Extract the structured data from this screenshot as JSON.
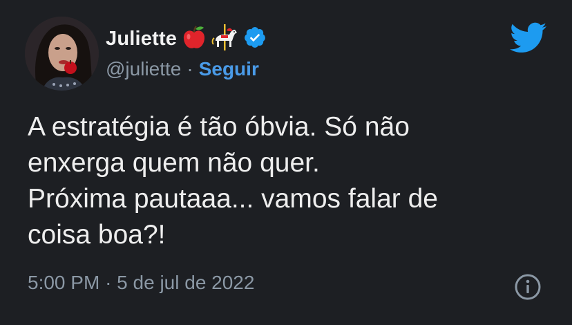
{
  "author": {
    "name": "Juliette",
    "handle": "@juliette",
    "separator": "·",
    "follow_label": "Seguir"
  },
  "tweet": {
    "lines": [
      "A estratégia é tão óbvia. Só não",
      "enxerga quem não quer.",
      "Próxima pautaaa... vamos falar de",
      "coisa boa?!"
    ],
    "time": "5:00 PM",
    "date": "5 de jul de 2022"
  },
  "colors": {
    "background": "#1d1f23",
    "accent": "#1d9bf0",
    "follow": "#4a9be8",
    "muted": "#8b98a5"
  },
  "icons": [
    "apple-emoji-icon",
    "carousel-horse-emoji-icon",
    "verified-badge-icon",
    "twitter-bird-icon",
    "info-icon"
  ]
}
